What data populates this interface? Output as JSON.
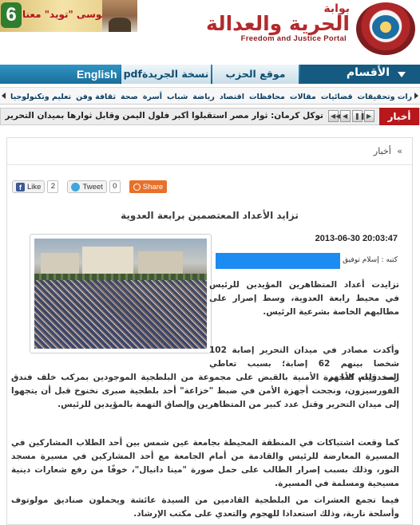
{
  "header": {
    "portal_word": "بوابة",
    "portal_name": "الحرية والعدالة",
    "portal_en": "Freedom and Justice Portal",
    "banner_number": "6",
    "banner_text": "موسى \"تويد\" معنا"
  },
  "mainnav": {
    "english": "English",
    "pdf_edition": "نسخة الجريدةpdf",
    "party_site": "موقع الحزب",
    "sections": "الأقسام"
  },
  "categories": [
    "حوارات وتحقيقات",
    "قضائيات",
    "مقالات",
    "محافظات",
    "اقتصاد",
    "رياضة",
    "شباب",
    "أسرة",
    "صحة",
    "ثقافة وفن",
    "تعليم وتكنولوجيا"
  ],
  "ticker": {
    "label": "أخبار",
    "text": "توكل كرمان: ثوار مصر استقبلوا أكبر فلول اليمن وقابل ثوارها بميدان التحرير"
  },
  "breadcrumb": {
    "item": "أخبار",
    "sep": "»"
  },
  "share": {
    "like_label": "Like",
    "like_count": "2",
    "tweet_label": "Tweet",
    "tweet_count": "0",
    "share_label": "Share"
  },
  "article": {
    "title": "تزايد الأعداد المعتصمين برابعة العدوية",
    "date": "2013-06-30 20:03:47",
    "author_label": "كتبه : إسلام توفيق",
    "p1": "تزايدت أعداد المتظاهرين المؤيدين للرئيس في محيط رابعة العدوية، وسط إصرار على مطالبهم الخاصة بشرعية الرئيس.",
    "p2a": "وأكدت مصادر في ميدان التحرير إصابة 102 شخصا بينهم 62 إصابة؛ بسبب تعاطي المخدرات، كما تم",
    "p2b": "رصد قيام الأجهزة الأمنية بالقبض على مجموعة من البلطجية الموجودين بمركب خلف فندق الفورسيزون، ونجحت أجهزة الأمن في ضبط \"خزاعة\" أحد بلطجية صبرى نخنوخ قبل أن يتجهوا إلى ميدان التحرير وقتل عدد كبير من المتظاهرين وإلصاق التهمة بالمؤيدين للرئيس.",
    "p3": "كما وقعت اشتباكات في المنطقة المحيطة بجامعة عين شمس بين أحد الطلاب المشاركين في المسيرة المعارضة للرئيس والقادمة من أمام الجامعة مع أحد المشاركين في مسيرة مسجد النور، وذلك بسبب إصرار الطالب على حمل صورة \"مينا دانيال\"، خوفًا من رفع شعارات دينية مسيحية ومسلمة في المسيرة.",
    "p4": "فيما تجمع العشرات من البلطجية القادمين من السيدة عائشة ويحملون صناديق مولوتوف وأسلحة نارية، وذلك استعدادا للهجوم والتعدي على مكتب الإرشاد."
  },
  "colors": {
    "brand_red": "#b22a2c",
    "nav_blue": "#16648e",
    "ticker_red": "#b8181b"
  }
}
